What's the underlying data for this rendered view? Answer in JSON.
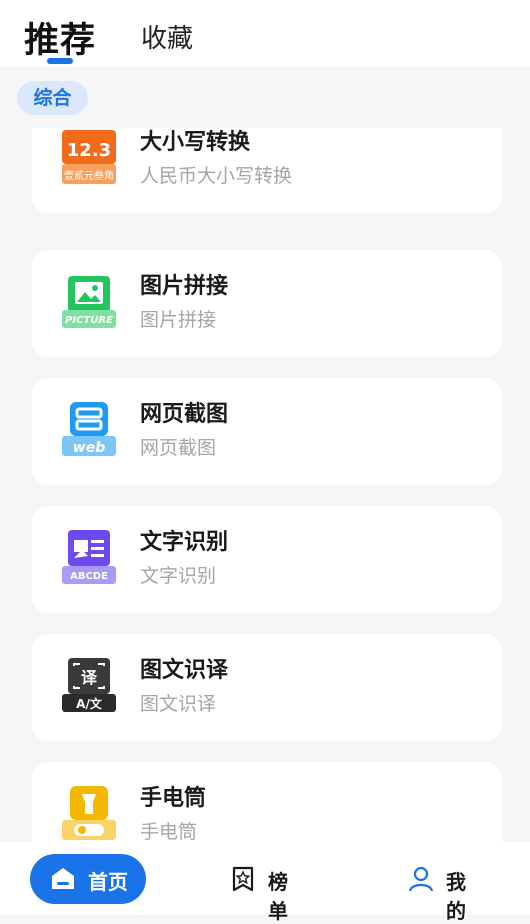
{
  "header": {
    "tabs": [
      {
        "label": "推荐",
        "active": true
      },
      {
        "label": "收藏",
        "active": false
      }
    ],
    "accent_color": "#1a73e8"
  },
  "category_chip": {
    "label": "综合"
  },
  "tools": [
    {
      "title": "大小写转换",
      "subtitle": "人民币大小写转换",
      "icon": "rmb-case-convert-icon",
      "icon_text": "12.3",
      "icon_caption": "壹贰元叁角"
    },
    {
      "title": "图片拼接",
      "subtitle": "图片拼接",
      "icon": "picture-stitch-icon",
      "icon_caption": "PICTURE"
    },
    {
      "title": "网页截图",
      "subtitle": "网页截图",
      "icon": "web-screenshot-icon",
      "icon_caption": "web"
    },
    {
      "title": "文字识别",
      "subtitle": "文字识别",
      "icon": "text-recognition-icon",
      "icon_caption": "ABCDE"
    },
    {
      "title": "图文识译",
      "subtitle": "图文识译",
      "icon": "image-translate-icon",
      "icon_text": "译",
      "icon_caption": "A/文"
    },
    {
      "title": "手电筒",
      "subtitle": "手电筒",
      "icon": "flashlight-icon"
    }
  ],
  "bottom_nav": [
    {
      "label": "首页",
      "icon": "home-icon",
      "active": true
    },
    {
      "label": "榜单",
      "icon": "ranking-icon",
      "active": false
    },
    {
      "label": "我的",
      "icon": "profile-icon",
      "active": false
    }
  ]
}
